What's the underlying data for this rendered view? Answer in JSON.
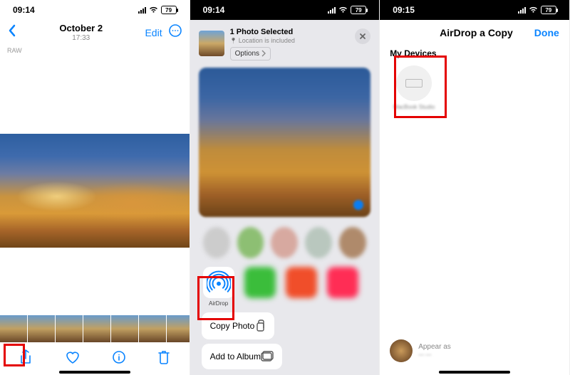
{
  "phone1": {
    "status": {
      "time": "09:14",
      "battery": "79"
    },
    "nav": {
      "date": "October 2",
      "time": "17:33",
      "edit": "Edit"
    },
    "raw": "RAW"
  },
  "phone2": {
    "status": {
      "time": "09:14",
      "battery": "79"
    },
    "selection": {
      "title": "1 Photo Selected",
      "subtitle": "Location is included",
      "options": "Options"
    },
    "apps": {
      "airdrop": "AirDrop"
    },
    "menu": {
      "copy": "Copy Photo",
      "add_album": "Add to Album"
    }
  },
  "phone3": {
    "status": {
      "time": "09:15",
      "battery": "79"
    },
    "nav": {
      "title": "AirDrop a Copy",
      "done": "Done"
    },
    "section": "My Devices",
    "device_name": "MacBook Studio",
    "appear_label": "Appear as",
    "appear_name": "— —"
  }
}
